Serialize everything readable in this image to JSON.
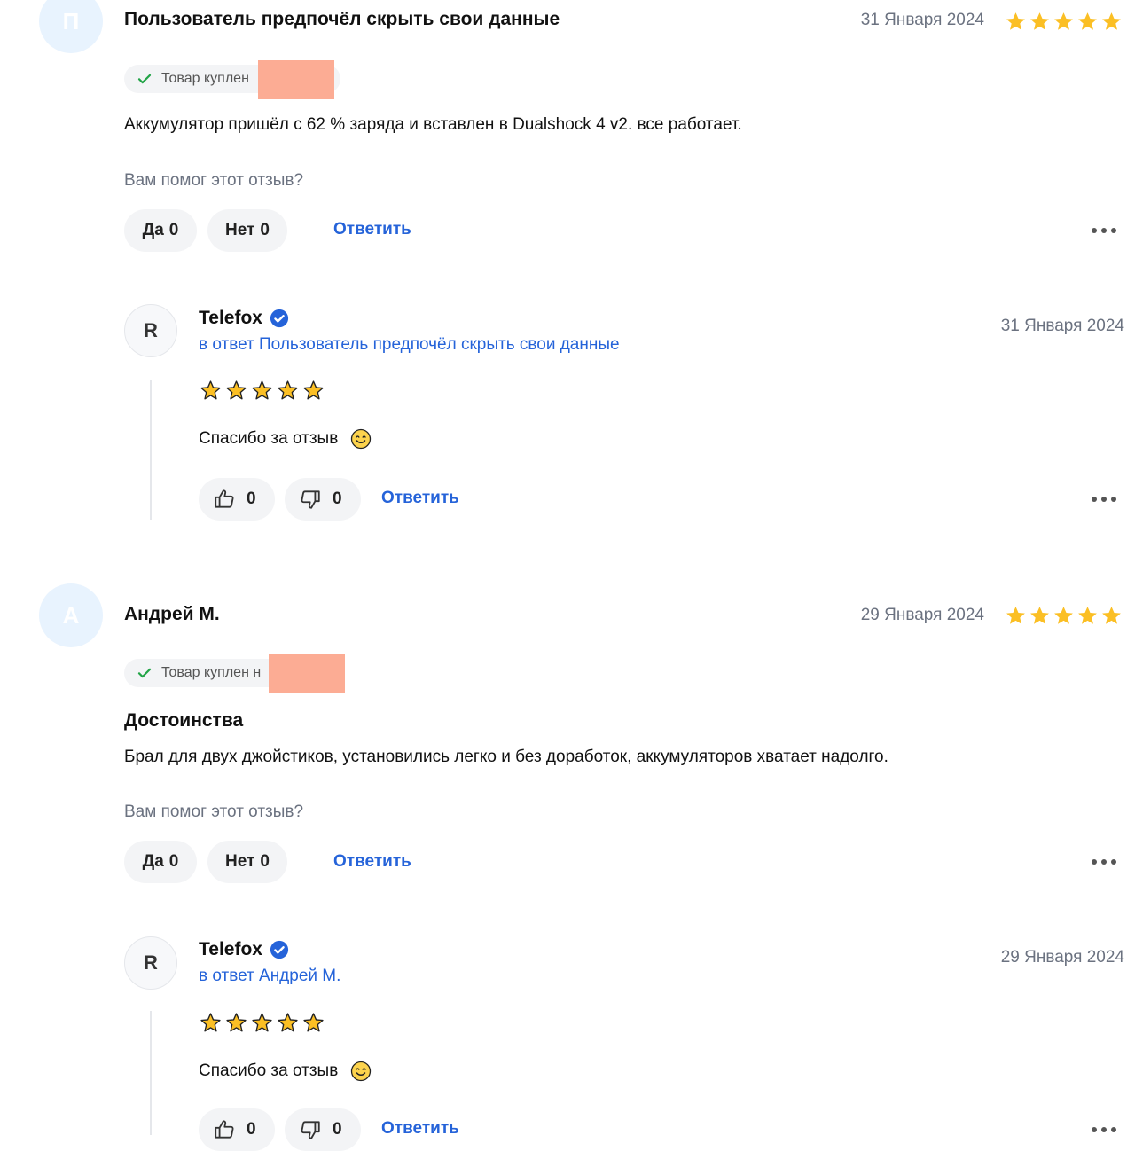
{
  "colors": {
    "accent": "#2563d9",
    "star": "#fbbf24",
    "redaction": "#fcac94",
    "verified": "#2563d9",
    "check": "#22a447"
  },
  "reviews": [
    {
      "avatar_letter": "П",
      "author": "Пользователь предпочёл скрыть свои данные",
      "date": "31 Января 2024",
      "rating": 5,
      "purchase_badge": "Товар куплен",
      "text": "Аккумулятор пришёл с 62 % заряда и вставлен в Dualshock 4 v2. все работает.",
      "helpful_question": "Вам помог этот отзыв?",
      "yes_label": "Да",
      "yes_count": "0",
      "no_label": "Нет",
      "no_count": "0",
      "reply_label": "Ответить",
      "more_icon": "ellipsis-icon",
      "reply": {
        "avatar_letter": "R",
        "author": "Telefox",
        "in_reply_to": "в ответ Пользователь предпочёл скрыть свои данные",
        "date": "31 Января 2024",
        "rating": 5,
        "text": "Спасибо за отзыв",
        "likes": "0",
        "dislikes": "0",
        "reply_label": "Ответить"
      }
    },
    {
      "avatar_letter": "А",
      "author": "Андрей М.",
      "date": "29 Января 2024",
      "rating": 5,
      "purchase_badge": "Товар куплен н",
      "section_title": "Достоинства",
      "text": "Брал для двух джойстиков, установились легко и без доработок, аккумуляторов хватает надолго.",
      "helpful_question": "Вам помог этот отзыв?",
      "yes_label": "Да",
      "yes_count": "0",
      "no_label": "Нет",
      "no_count": "0",
      "reply_label": "Ответить",
      "more_icon": "ellipsis-icon",
      "reply": {
        "avatar_letter": "R",
        "author": "Telefox",
        "in_reply_to": "в ответ Андрей М.",
        "date": "29 Января 2024",
        "rating": 5,
        "text": "Спасибо за отзыв",
        "likes": "0",
        "dislikes": "0",
        "reply_label": "Ответить"
      }
    }
  ]
}
